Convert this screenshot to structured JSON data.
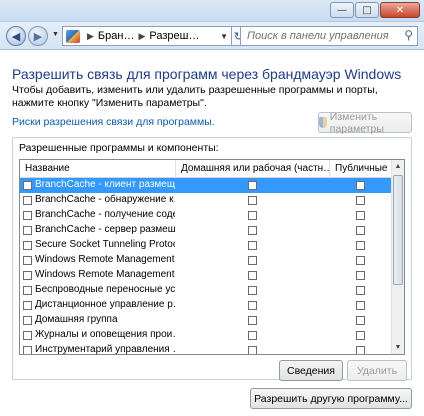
{
  "window": {
    "minimize_icon": "minimize-icon",
    "maximize_icon": "maximize-icon",
    "close_icon": "close-icon"
  },
  "nav": {
    "breadcrumb": [
      "Бран…",
      "Разреш…"
    ],
    "search_placeholder": "Поиск в панели управления"
  },
  "page": {
    "heading": "Разрешить связь для программ через брандмауэр Windows",
    "description": "Чтобы добавить, изменить или удалить разрешенные программы и порты, нажмите кнопку \"Изменить параметры\".",
    "risk_link": "Риски разрешения связи для программы.",
    "change_settings_label": "Изменить параметры"
  },
  "programs": {
    "group_title": "Разрешенные программы и компоненты:",
    "columns": [
      "Название",
      "Домашняя или рабочая (частн…",
      "Публичные"
    ],
    "rows": [
      {
        "name": "BranchCache - клиент размещ…",
        "enabled": false,
        "home": false,
        "public": false,
        "selected": true
      },
      {
        "name": "BranchCache - обнаружение к…",
        "enabled": false,
        "home": false,
        "public": false,
        "selected": false
      },
      {
        "name": "BranchCache - получение соде…",
        "enabled": false,
        "home": false,
        "public": false,
        "selected": false
      },
      {
        "name": "BranchCache - сервер размещ…",
        "enabled": false,
        "home": false,
        "public": false,
        "selected": false
      },
      {
        "name": "Secure Socket Tunneling Protocol",
        "enabled": false,
        "home": false,
        "public": false,
        "selected": false
      },
      {
        "name": "Windows Remote Management",
        "enabled": false,
        "home": false,
        "public": false,
        "selected": false
      },
      {
        "name": "Windows Remote Management …",
        "enabled": false,
        "home": false,
        "public": false,
        "selected": false
      },
      {
        "name": "Беспроводные переносные ус…",
        "enabled": false,
        "home": false,
        "public": false,
        "selected": false
      },
      {
        "name": "Дистанционное управление р…",
        "enabled": false,
        "home": false,
        "public": false,
        "selected": false
      },
      {
        "name": "Домашняя группа",
        "enabled": false,
        "home": false,
        "public": false,
        "selected": false
      },
      {
        "name": "Журналы и оповещения прои…",
        "enabled": false,
        "home": false,
        "public": false,
        "selected": false
      },
      {
        "name": "Инструментарий управления …",
        "enabled": false,
        "home": false,
        "public": false,
        "selected": false
      }
    ],
    "details_label": "Сведения",
    "remove_label": "Удалить"
  },
  "footer": {
    "allow_other_label": "Разрешить другую программу..."
  }
}
